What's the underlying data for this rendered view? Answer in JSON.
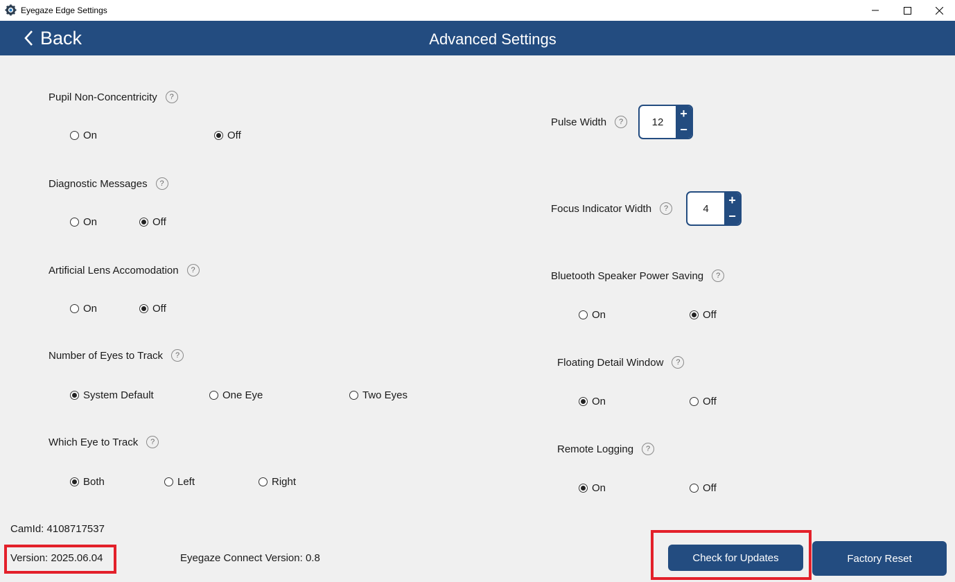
{
  "window": {
    "title": "Eyegaze Edge Settings"
  },
  "header": {
    "back_label": "Back",
    "title": "Advanced Settings"
  },
  "settings_left": [
    {
      "label": "Pupil Non-Concentricity",
      "options": [
        {
          "label": "On",
          "checked": false
        },
        {
          "label": "Off",
          "checked": true
        }
      ]
    },
    {
      "label": "Diagnostic Messages",
      "options": [
        {
          "label": "On",
          "checked": false
        },
        {
          "label": "Off",
          "checked": true
        }
      ]
    },
    {
      "label": "Artificial Lens Accomodation",
      "options": [
        {
          "label": "On",
          "checked": false
        },
        {
          "label": "Off",
          "checked": true
        }
      ]
    },
    {
      "label": "Number of Eyes to Track",
      "options": [
        {
          "label": "System Default",
          "checked": true
        },
        {
          "label": "One Eye",
          "checked": false
        },
        {
          "label": "Two Eyes",
          "checked": false
        }
      ]
    },
    {
      "label": "Which Eye to Track",
      "options": [
        {
          "label": "Both",
          "checked": true
        },
        {
          "label": "Left",
          "checked": false
        },
        {
          "label": "Right",
          "checked": false
        }
      ]
    }
  ],
  "steppers": [
    {
      "label": "Pulse Width",
      "value": "12"
    },
    {
      "label": "Focus Indicator Width",
      "value": "4"
    }
  ],
  "settings_right": [
    {
      "label": "Bluetooth Speaker Power Saving",
      "options": [
        {
          "label": "On",
          "checked": false
        },
        {
          "label": "Off",
          "checked": true
        }
      ]
    },
    {
      "label": "Floating Detail Window",
      "options": [
        {
          "label": "On",
          "checked": true
        },
        {
          "label": "Off",
          "checked": false
        }
      ]
    },
    {
      "label": "Remote Logging",
      "options": [
        {
          "label": "On",
          "checked": true
        },
        {
          "label": "Off",
          "checked": false
        }
      ]
    }
  ],
  "help_glyph": "?",
  "stepper_plus": "+",
  "stepper_minus": "−",
  "footer": {
    "camid": "CamId: 4108717537",
    "version": "Version: 2025.06.04",
    "connect_version": "Eyegaze Connect Version: 0.8",
    "check_updates_label": "Check for Updates",
    "factory_reset_label": "Factory Reset"
  },
  "colors": {
    "header": "#234c80",
    "highlight": "#e3202a",
    "background": "#f0f0f0"
  }
}
